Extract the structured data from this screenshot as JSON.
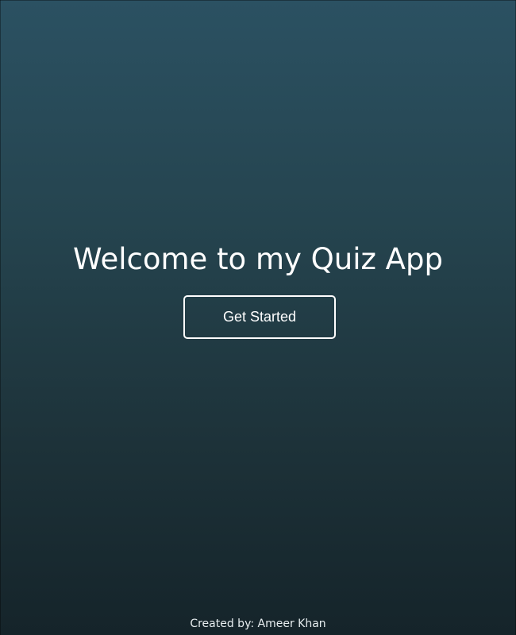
{
  "main": {
    "title": "Welcome to my Quiz App",
    "start_label": "Get Started"
  },
  "footer": {
    "credit": "Created by: Ameer Khan"
  }
}
